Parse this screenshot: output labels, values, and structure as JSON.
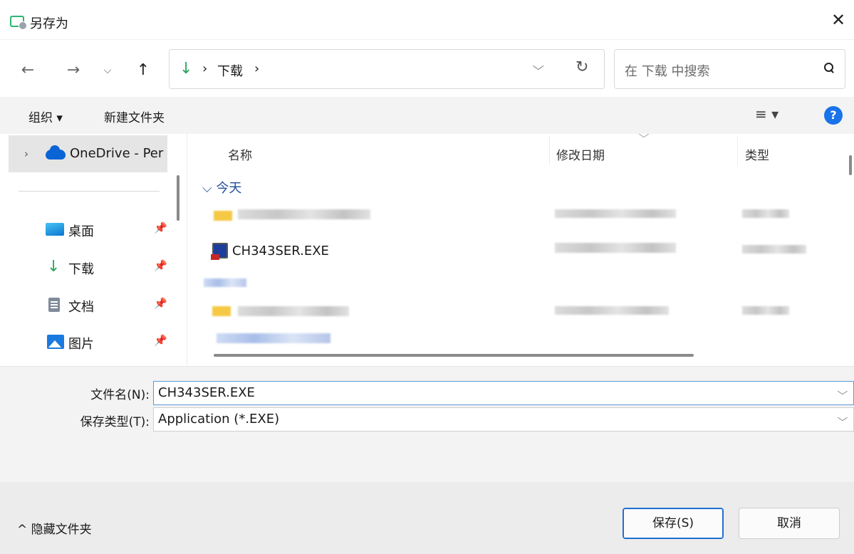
{
  "window": {
    "title": "另存为",
    "close": "✕"
  },
  "nav": {
    "back": "←",
    "forward": "→",
    "recent": "⌵",
    "up": "↑"
  },
  "address": {
    "download_icon": "↓",
    "sep": "›",
    "crumb": "下载",
    "dropdown": "⌵",
    "refresh": "↻"
  },
  "search": {
    "placeholder": "在 下载 中搜索"
  },
  "toolbar": {
    "organize": "组织 ▾",
    "new_folder": "新建文件夹",
    "view": "≡ ▾",
    "help": "?"
  },
  "sidebar": {
    "onedrive": "OneDrive - Per",
    "onedrive_chev": "›",
    "pin": "📌",
    "items": [
      {
        "label": "桌面",
        "icon": "desktop-icon"
      },
      {
        "label": "下载",
        "icon": "download-icon",
        "glyph": "↓"
      },
      {
        "label": "文档",
        "icon": "document-icon"
      },
      {
        "label": "图片",
        "icon": "pictures-icon"
      }
    ]
  },
  "columns": {
    "name": "名称",
    "date": "修改日期",
    "type": "类型",
    "sort": "⌵"
  },
  "groups": {
    "today": "⌵ 今天"
  },
  "files": [
    {
      "name": "CH343SER.EXE",
      "icon": "exe-icon"
    }
  ],
  "bottom": {
    "filename_label": "文件名(N):",
    "filename_value": "CH343SER.EXE",
    "filetype_label": "保存类型(T):",
    "filetype_value": "Application (*.EXE)",
    "combo_chev": "⌵",
    "hide_folders": "^ 隐藏文件夹",
    "save": "保存(S)",
    "cancel": "取消"
  }
}
